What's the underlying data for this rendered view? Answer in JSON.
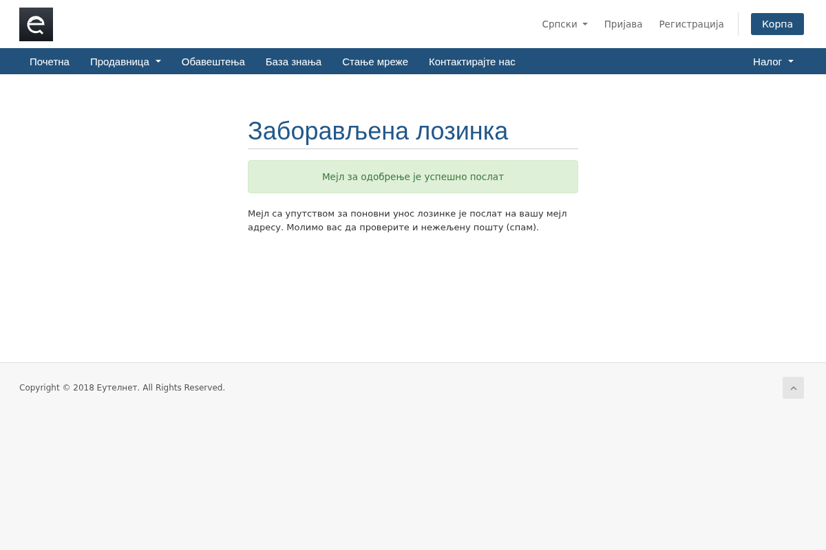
{
  "header": {
    "language": {
      "label": "Српски",
      "dropdown": true
    },
    "links": [
      "Пријава",
      "Регистрација"
    ],
    "cart_button": "Корпа"
  },
  "nav": {
    "items": [
      {
        "label": "Почетна",
        "dropdown": false
      },
      {
        "label": "Продавница",
        "dropdown": true
      },
      {
        "label": "Обавештења",
        "dropdown": false
      },
      {
        "label": "База знања",
        "dropdown": false
      },
      {
        "label": "Стање мреже",
        "dropdown": false
      },
      {
        "label": "Контактирајте нас",
        "dropdown": false
      }
    ],
    "account": {
      "label": "Налог",
      "dropdown": true
    }
  },
  "page": {
    "title": "Заборављена лозинка",
    "alert": "Мејл за одобрење је успешно послат",
    "message": "Мејл са упутством за поновни унос лозинке је послат на вашу мејл адресу. Молимо вас да проверите и нежељену пошту (спам)."
  },
  "footer": {
    "copyright": "Copyright © 2018 Еутелнет. All Rights Reserved."
  }
}
